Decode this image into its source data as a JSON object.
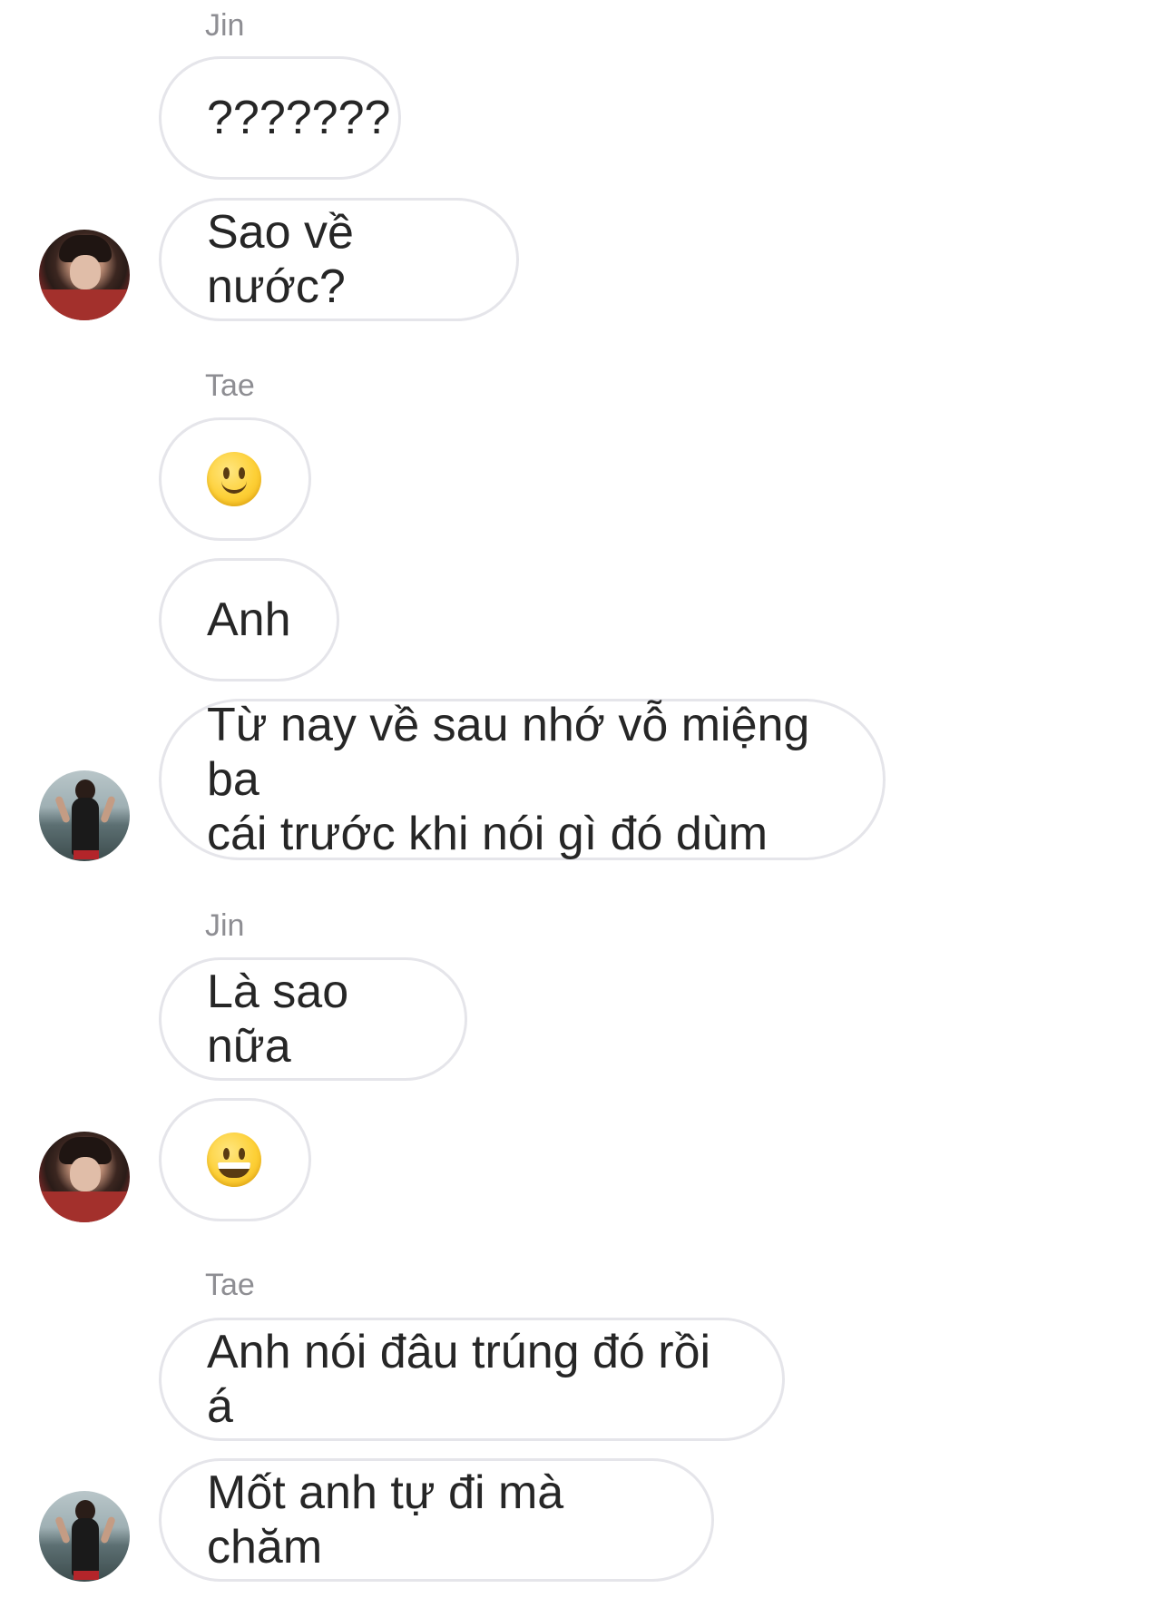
{
  "conversation": {
    "groups": [
      {
        "sender": "Jin",
        "messages": [
          {
            "text": "???????"
          },
          {
            "text": "Sao về nước?"
          }
        ]
      },
      {
        "sender": "Tae",
        "messages": [
          {
            "emoji": "slightly-smiling-face",
            "text": "🙂"
          },
          {
            "text": "Anh"
          },
          {
            "text": "Từ nay về sau nhớ vỗ miệng ba\ncái trước khi nói gì đó dùm"
          }
        ]
      },
      {
        "sender": "Jin",
        "messages": [
          {
            "text": "Là sao nữa"
          },
          {
            "emoji": "grinning-face",
            "text": "😀"
          }
        ]
      },
      {
        "sender": "Tae",
        "messages": [
          {
            "text": "Anh nói đâu trúng đó rồi á"
          },
          {
            "text": "Mốt anh tự đi mà chăm"
          }
        ]
      }
    ]
  },
  "colors": {
    "bubble_border": "#e5e5ea",
    "bubble_text": "#262626",
    "sender_name": "#8e8e93",
    "background": "#ffffff"
  }
}
